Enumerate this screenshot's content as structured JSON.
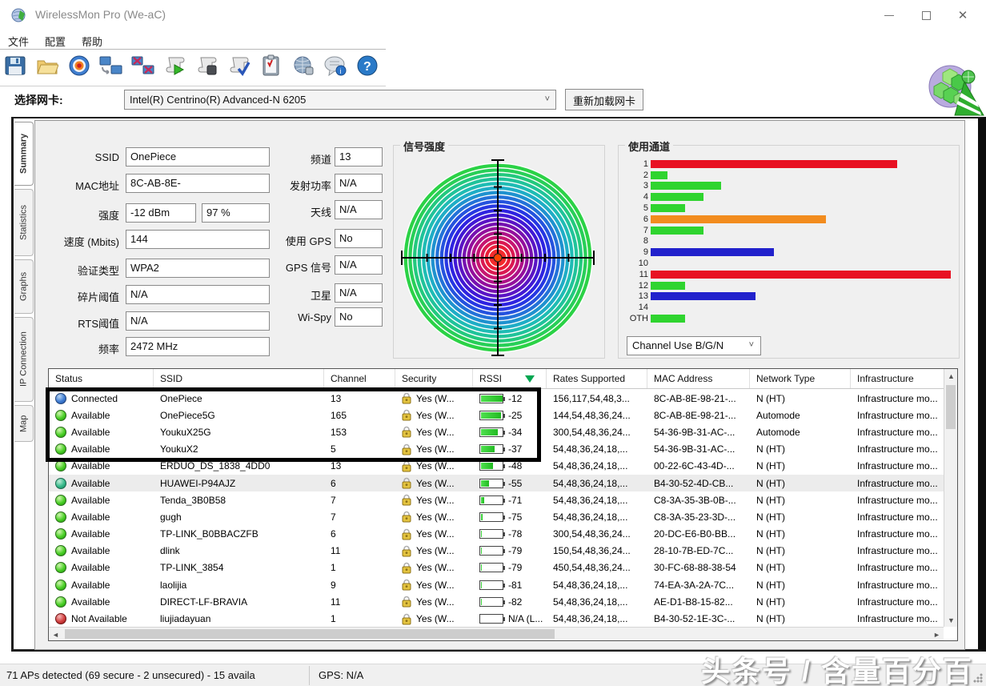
{
  "window": {
    "title": "WirelessMon Pro (We-aC)",
    "controls": {
      "minimize": "minimize",
      "maximize": "maximize",
      "close": "close"
    }
  },
  "menu": {
    "items": [
      {
        "label": "文件"
      },
      {
        "label": "配置"
      },
      {
        "label": "帮助"
      }
    ]
  },
  "toolbar": {
    "icons": [
      "save",
      "open",
      "target",
      "reconnect",
      "disconnect",
      "start-log",
      "stop-log",
      "verify-log",
      "report",
      "web-check",
      "chat-info",
      "help"
    ]
  },
  "adapter": {
    "label": "选择网卡:",
    "selected": "Intel(R) Centrino(R) Advanced-N 6205",
    "reload_button": "重新加载网卡"
  },
  "sidebar": {
    "tabs": [
      {
        "label": "Summary",
        "active": true
      },
      {
        "label": "Statistics",
        "active": false
      },
      {
        "label": "Graphs",
        "active": false
      },
      {
        "label": "IP Connection",
        "active": false
      },
      {
        "label": "Map",
        "active": false
      }
    ]
  },
  "summary_form": {
    "fields": [
      {
        "label": "SSID",
        "value": "OnePiece"
      },
      {
        "label": "MAC地址",
        "value": "8C-AB-8E-"
      },
      {
        "label": "强度",
        "value": "-12 dBm",
        "value2": "97 %"
      },
      {
        "label": "速度 (Mbits)",
        "value": "144"
      },
      {
        "label": "验证类型",
        "value": "WPA2"
      },
      {
        "label": "碎片阈值",
        "value": "N/A"
      },
      {
        "label": "RTS阈值",
        "value": "N/A"
      },
      {
        "label": "频率",
        "value": "2472 MHz"
      }
    ]
  },
  "right_form": {
    "fields": [
      {
        "label": "频道",
        "value": "13"
      },
      {
        "label": "发射功率",
        "value": "N/A"
      },
      {
        "label": "天线",
        "value": "N/A"
      },
      {
        "label": "使用 GPS",
        "value": "No"
      },
      {
        "label": "GPS 信号",
        "value": "N/A"
      },
      {
        "label": "卫星",
        "value": "N/A"
      },
      {
        "label": "Wi-Spy",
        "value": "No"
      }
    ]
  },
  "signal_panel": {
    "title": "信号强度",
    "ring_colors": [
      "#2bd246",
      "#28cf58",
      "#23c97e",
      "#20c39a",
      "#1fbcb4",
      "#1fadc6",
      "#1f92cf",
      "#2372d8",
      "#2553de",
      "#2737e2",
      "#2f23e0",
      "#4119d4",
      "#5a14c4",
      "#7611b0",
      "#93109c",
      "#ae1288",
      "#c61670",
      "#da1a52",
      "#ea1e38",
      "#f42c2c"
    ],
    "center_color": "#ff4400",
    "axis_color": "#000000"
  },
  "channel_panel": {
    "title": "使用通道",
    "dropdown_value": "Channel Use B/G/N",
    "chart_data": {
      "type": "bar",
      "orientation": "horizontal",
      "categories": [
        "1",
        "2",
        "3",
        "4",
        "5",
        "6",
        "7",
        "8",
        "9",
        "10",
        "11",
        "12",
        "13",
        "14",
        "OTH"
      ],
      "values_percent": [
        82,
        5.5,
        23.5,
        17.5,
        11.5,
        58.5,
        17.5,
        0,
        41,
        0,
        100,
        11.5,
        35,
        0,
        11.5
      ],
      "colors": [
        "#e81123",
        "#2fd42f",
        "#2fd42f",
        "#2fd42f",
        "#2fd42f",
        "#f28c1e",
        "#2fd42f",
        "",
        "#2222cc",
        "",
        "#e81123",
        "#2fd42f",
        "#2222cc",
        "",
        "#2fd42f"
      ]
    }
  },
  "table": {
    "columns": [
      "Status",
      "SSID",
      "Channel",
      "Security",
      "RSSI",
      "Rates Supported",
      "MAC Address",
      "Network Type",
      "Infrastructure"
    ],
    "sorted_column": "RSSI",
    "rows": [
      {
        "status": "Connected",
        "orb": "blue",
        "ssid": "OnePiece",
        "channel": "13",
        "security": "Yes (W...",
        "rssi": "-12",
        "fill": 95,
        "rates": "156,117,54,48,3...",
        "mac": "8C-AB-8E-98-21-...",
        "type": "N (HT)",
        "infra": "Infrastructure mo...",
        "highlight": false
      },
      {
        "status": "Available",
        "orb": "green",
        "ssid": "OnePiece5G",
        "channel": "165",
        "security": "Yes (W...",
        "rssi": "-25",
        "fill": 88,
        "rates": "144,54,48,36,24...",
        "mac": "8C-AB-8E-98-21-...",
        "type": "Automode",
        "infra": "Infrastructure mo...",
        "highlight": false
      },
      {
        "status": "Available",
        "orb": "green",
        "ssid": "YoukuX25G",
        "channel": "153",
        "security": "Yes (W...",
        "rssi": "-34",
        "fill": 75,
        "rates": "300,54,48,36,24...",
        "mac": "54-36-9B-31-AC-...",
        "type": "Automode",
        "infra": "Infrastructure mo...",
        "highlight": false
      },
      {
        "status": "Available",
        "orb": "green",
        "ssid": "YoukuX2",
        "channel": "5",
        "security": "Yes (W...",
        "rssi": "-37",
        "fill": 62,
        "rates": "54,48,36,24,18,...",
        "mac": "54-36-9B-31-AC-...",
        "type": "N (HT)",
        "infra": "Infrastructure mo...",
        "highlight": false
      },
      {
        "status": "Available",
        "orb": "green",
        "ssid": "ERDUO_DS_1838_4DD0",
        "channel": "13",
        "security": "Yes (W...",
        "rssi": "-48",
        "fill": 55,
        "rates": "54,48,36,24,18,...",
        "mac": "00-22-6C-43-4D-...",
        "type": "N (HT)",
        "infra": "Infrastructure mo...",
        "highlight": false
      },
      {
        "status": "Available",
        "orb": "teal",
        "ssid": "HUAWEI-P94AJZ",
        "channel": "6",
        "security": "Yes (W...",
        "rssi": "-55",
        "fill": 35,
        "rates": "54,48,36,24,18,...",
        "mac": "B4-30-52-4D-CB...",
        "type": "N (HT)",
        "infra": "Infrastructure mo...",
        "highlight": true
      },
      {
        "status": "Available",
        "orb": "green",
        "ssid": "Tenda_3B0B58",
        "channel": "7",
        "security": "Yes (W...",
        "rssi": "-71",
        "fill": 14,
        "rates": "54,48,36,24,18,...",
        "mac": "C8-3A-35-3B-0B-...",
        "type": "N (HT)",
        "infra": "Infrastructure mo...",
        "highlight": false
      },
      {
        "status": "Available",
        "orb": "green",
        "ssid": "gugh",
        "channel": "7",
        "security": "Yes (W...",
        "rssi": "-75",
        "fill": 7,
        "rates": "54,48,36,24,18,...",
        "mac": "C8-3A-35-23-3D-...",
        "type": "N (HT)",
        "infra": "Infrastructure mo...",
        "highlight": false
      },
      {
        "status": "Available",
        "orb": "green",
        "ssid": "TP-LINK_B0BBACZFB",
        "channel": "6",
        "security": "Yes (W...",
        "rssi": "-78",
        "fill": 5,
        "rates": "300,54,48,36,24...",
        "mac": "20-DC-E6-B0-BB...",
        "type": "N (HT)",
        "infra": "Infrastructure mo...",
        "highlight": false
      },
      {
        "status": "Available",
        "orb": "green",
        "ssid": "dlink",
        "channel": "11",
        "security": "Yes (W...",
        "rssi": "-79",
        "fill": 5,
        "rates": "150,54,48,36,24...",
        "mac": "28-10-7B-ED-7C...",
        "type": "N (HT)",
        "infra": "Infrastructure mo...",
        "highlight": false
      },
      {
        "status": "Available",
        "orb": "green",
        "ssid": "TP-LINK_3854",
        "channel": "1",
        "security": "Yes (W...",
        "rssi": "-79",
        "fill": 5,
        "rates": "450,54,48,36,24...",
        "mac": "30-FC-68-88-38-54",
        "type": "N (HT)",
        "infra": "Infrastructure mo...",
        "highlight": false
      },
      {
        "status": "Available",
        "orb": "green",
        "ssid": "laolijia",
        "channel": "9",
        "security": "Yes (W...",
        "rssi": "-81",
        "fill": 4,
        "rates": "54,48,36,24,18,...",
        "mac": "74-EA-3A-2A-7C...",
        "type": "N (HT)",
        "infra": "Infrastructure mo...",
        "highlight": false
      },
      {
        "status": "Available",
        "orb": "green",
        "ssid": "DIRECT-LF-BRAVIA",
        "channel": "11",
        "security": "Yes (W...",
        "rssi": "-82",
        "fill": 3,
        "rates": "54,48,36,24,18,...",
        "mac": "AE-D1-B8-15-82...",
        "type": "N (HT)",
        "infra": "Infrastructure mo...",
        "highlight": false
      },
      {
        "status": "Not Available",
        "orb": "red",
        "ssid": "liujiadayuan",
        "channel": "1",
        "security": "Yes (W...",
        "rssi": "N/A (L...",
        "fill": 0,
        "rates": "54,48,36,24,18,...",
        "mac": "B4-30-52-1E-3C-...",
        "type": "N (HT)",
        "infra": "Infrastructure mo...",
        "highlight": false
      }
    ]
  },
  "status_bar": {
    "summary": "71 APs detected (69 secure - 2 unsecured) - 15 availa",
    "gps": "GPS: N/A"
  },
  "watermark": "头条号 / 含量百分百",
  "colors": {
    "accent_green": "#00a651",
    "bar_red": "#e81123",
    "bar_green": "#2fd42f",
    "bar_orange": "#f28c1e",
    "bar_blue": "#2222cc"
  }
}
